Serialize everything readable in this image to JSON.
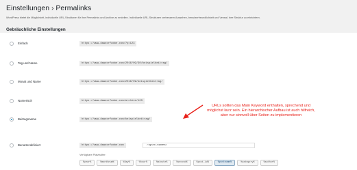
{
  "page": {
    "title": "Einstellungen › Permalinks",
    "intro": "WordPress bietet die Möglichkeit, individuelle URL-Strukturen für ihre Permalinks und Archive zu erstellen. Individuelle URL-Strukturen verbessern Aussehen, benutzerfreundlichkeit und Verwal- bee Struktur zu erleichtern."
  },
  "section": {
    "title": "Gebräuchliche Einstellungen"
  },
  "options": [
    {
      "label": "Einfach",
      "example": "https://www.dawoorfwdoe.com/?p=123",
      "checked": false
    },
    {
      "label": "Tag und Name",
      "example": "https://www.dawoorfwdoe.com/2016/09/30/beispielbeitrag/",
      "checked": false
    },
    {
      "label": "Monat und Name",
      "example": "https://www.dawoorfwdoe.com/2016/09/beispielbeitrag/",
      "checked": false
    },
    {
      "label": "Numerisch",
      "example": "https://www.dawoorfwdoe.com/archive/123",
      "checked": false
    },
    {
      "label": "Beitragsname",
      "example": "https://www.dawoorfwdoe.com/beispielbeitrag/",
      "checked": true
    },
    {
      "label": "Benutzerdefiniert",
      "example": "https://www.dawoorfwdoe.com",
      "checked": false,
      "value": "/%postname%/"
    }
  ],
  "available": {
    "label": "Verfügbare Platzhalter:",
    "tags": [
      "%year%",
      "%monthnum%",
      "%day%",
      "%hour%",
      "%minute%",
      "%second%",
      "%post_id%",
      "%postname%",
      "%category%",
      "%author%"
    ],
    "active_index": 7
  },
  "annotation": {
    "text": "URLs sollten das Main Keyword enthalten, sprechend und möglichst kurz sein. Ein hierarchischer Aufbau ist auch hilfreich, aber nur sinnvoll über Seiten zu implementieren",
    "color": "#e8211a"
  }
}
